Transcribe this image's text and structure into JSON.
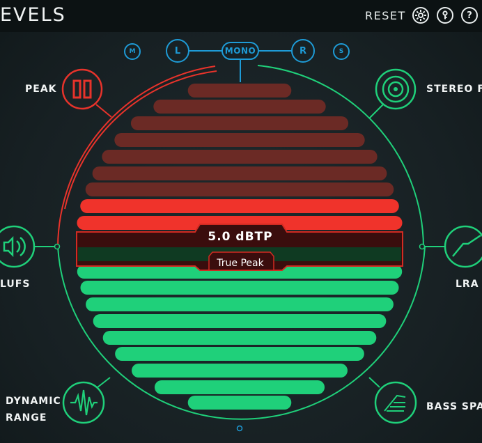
{
  "app": {
    "title": "EVELS"
  },
  "toolbar": {
    "reset_label": "RESET",
    "settings_icon": "gear-icon",
    "key_icon": "key-icon",
    "help_label": "?"
  },
  "channels": {
    "m": "M",
    "l": "L",
    "mono": "MONO",
    "r": "R",
    "s": "S"
  },
  "modules": {
    "peak": "PEAK",
    "stereo_field": "STEREO FI",
    "lufs": "LUFS",
    "lra": "LRA",
    "dynamic_range_line1": "DYNAMIC",
    "dynamic_range_line2": "RANGE",
    "bass_space": "BASS SPA"
  },
  "meter": {
    "value": "5.0 dBTP",
    "label": "True Peak"
  },
  "colors": {
    "accent_green": "#1fd07a",
    "accent_red": "#f0332b",
    "accent_blue": "#1e9bd6"
  }
}
